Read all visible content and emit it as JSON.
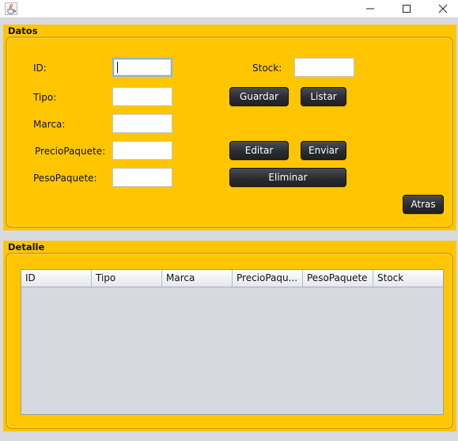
{
  "window": {
    "icon": "java-cup-icon",
    "controls": [
      "minimize-icon",
      "maximize-icon",
      "close-icon"
    ]
  },
  "datos": {
    "title": "Datos",
    "labels": {
      "id": "ID:",
      "tipo": "Tipo:",
      "marca": "Marca:",
      "precio": "PrecioPaquete:",
      "peso": "PesoPaquete:",
      "stock": "Stock:"
    },
    "fields": {
      "id": "",
      "tipo": "",
      "marca": "",
      "precio": "",
      "peso": "",
      "stock": ""
    },
    "buttons": {
      "guardar": "Guardar",
      "listar": "Listar",
      "editar": "Editar",
      "enviar": "Enviar",
      "eliminar": "Eliminar",
      "atras": "Atras"
    }
  },
  "detalle": {
    "title": "Detalle",
    "columns": [
      "ID",
      "Tipo",
      "Marca",
      "PrecioPaqu...",
      "PesoPaquete",
      "Stock"
    ],
    "rows": []
  },
  "colors": {
    "panel": "#ffc600",
    "button": "#2a2c30",
    "background": "#d8dae0"
  }
}
